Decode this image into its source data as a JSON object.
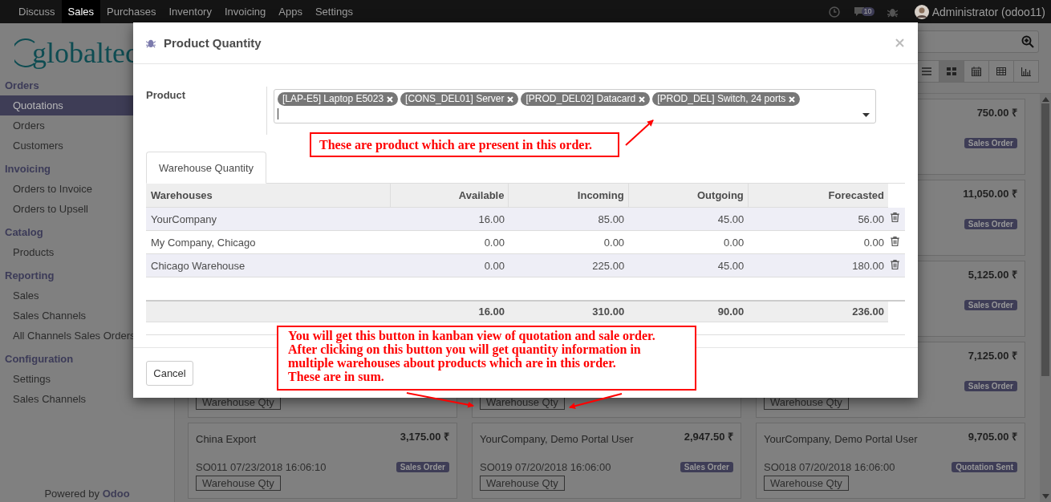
{
  "navbar": {
    "apps": [
      {
        "label": "Discuss",
        "selected": false
      },
      {
        "label": "Sales",
        "selected": true
      },
      {
        "label": "Purchases",
        "selected": false
      },
      {
        "label": "Inventory",
        "selected": false
      },
      {
        "label": "Invoicing",
        "selected": false
      },
      {
        "label": "Apps",
        "selected": false
      },
      {
        "label": "Settings",
        "selected": false
      }
    ],
    "message_count": "10",
    "user": "Administrator (odoo11)"
  },
  "sidebar": {
    "logo": "globaltec",
    "sections": [
      {
        "title": "Orders",
        "items": [
          {
            "label": "Quotations",
            "selected": true
          },
          {
            "label": "Orders",
            "selected": false
          },
          {
            "label": "Customers",
            "selected": false
          }
        ]
      },
      {
        "title": "Invoicing",
        "items": [
          {
            "label": "Orders to Invoice",
            "selected": false
          },
          {
            "label": "Orders to Upsell",
            "selected": false
          }
        ]
      },
      {
        "title": "Catalog",
        "items": [
          {
            "label": "Products",
            "selected": false
          }
        ]
      },
      {
        "title": "Reporting",
        "items": [
          {
            "label": "Sales",
            "selected": false
          },
          {
            "label": "Sales Channels",
            "selected": false
          },
          {
            "label": "All Channels Sales Orders",
            "selected": false
          }
        ]
      },
      {
        "title": "Configuration",
        "items": [
          {
            "label": "Settings",
            "selected": false
          },
          {
            "label": "Sales Channels",
            "selected": false
          }
        ]
      }
    ],
    "footer_text": "Powered by",
    "footer_link": "Odoo"
  },
  "control_panel": {
    "views": [
      {
        "kind": "list",
        "selected": false
      },
      {
        "kind": "kanban",
        "selected": true
      },
      {
        "kind": "calendar",
        "selected": false
      },
      {
        "kind": "pivot",
        "selected": false
      },
      {
        "kind": "graph",
        "selected": false
      }
    ]
  },
  "kanban": {
    "columns": [
      [
        {
          "button": "Warehouse Qty"
        },
        {
          "name": "China Export",
          "amount": "3,175.00 ₹",
          "ref": "SO011 07/23/2018 16:06:10",
          "badge": "Sales Order",
          "button": "Warehouse Qty"
        }
      ],
      [
        {
          "button": "Warehouse Qty"
        },
        {
          "name": "YourCompany, Demo Portal User",
          "amount": "2,947.50 ₹",
          "ref": "SO019 07/20/2018 16:06:00",
          "badge": "Sales Order",
          "button": "Warehouse Qty"
        }
      ],
      [
        {
          "amount": "750.00 ₹",
          "badge": "Sales Order"
        },
        {
          "amount": "11,050.00 ₹",
          "badge": "Sales Order"
        },
        {
          "amount": "5,125.00 ₹",
          "badge": "Sales Order"
        },
        {
          "amount": "7,125.00 ₹",
          "badge": "Sales Order",
          "button": "Warehouse Qty"
        },
        {
          "name": "YourCompany, Demo Portal User",
          "amount": "9,705.00 ₹",
          "ref": "SO018 07/20/2018 16:06:00",
          "badge": "Quotation Sent",
          "button": "Warehouse Qty"
        }
      ]
    ]
  },
  "dialog": {
    "title": "Product Quantity",
    "product_label": "Product",
    "products": [
      "[LAP-E5] Laptop E5023",
      "[CONS_DEL01] Server",
      "[PROD_DEL02] Datacard",
      "[PROD_DEL] Switch, 24 ports"
    ],
    "tabs": [
      {
        "label": "Warehouse Quantity",
        "selected": true
      }
    ],
    "columns": [
      "Warehouses",
      "Available",
      "Incoming",
      "Outgoing",
      "Forecasted"
    ],
    "rows": [
      [
        "YourCompany",
        "16.00",
        "85.00",
        "45.00",
        "56.00"
      ],
      [
        "My Company, Chicago",
        "0.00",
        "0.00",
        "0.00",
        "0.00"
      ],
      [
        "Chicago Warehouse",
        "0.00",
        "225.00",
        "45.00",
        "180.00"
      ]
    ],
    "totals": [
      "16.00",
      "310.00",
      "90.00",
      "236.00"
    ],
    "cancel": "Cancel"
  },
  "annotations": [
    {
      "text": "These are product which are present in this order."
    },
    {
      "text": "You will get this button in kanban view of quotation and sale order.\nAfter clicking on this button you will get quantity information in\nmultiple warehouses about products which are in this order.\nThese are in sum."
    }
  ]
}
